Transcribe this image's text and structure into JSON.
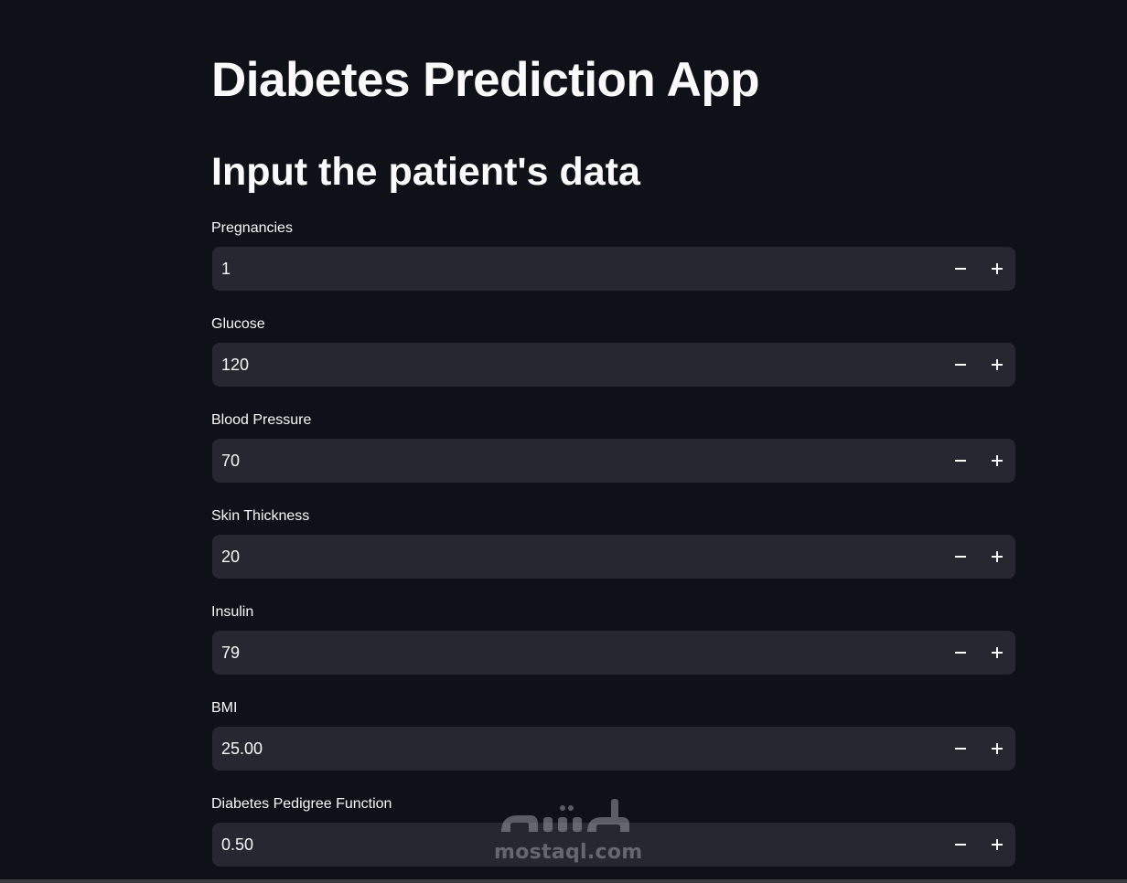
{
  "app": {
    "title": "Diabetes Prediction App",
    "section_title": "Input the patient's data"
  },
  "fields": [
    {
      "label": "Pregnancies",
      "value": "1"
    },
    {
      "label": "Glucose",
      "value": "120"
    },
    {
      "label": "Blood Pressure",
      "value": "70"
    },
    {
      "label": "Skin Thickness",
      "value": "20"
    },
    {
      "label": "Insulin",
      "value": "79"
    },
    {
      "label": "BMI",
      "value": "25.00"
    },
    {
      "label": "Diabetes Pedigree Function",
      "value": "0.50"
    }
  ],
  "icons": {
    "decrement": "minus-icon",
    "increment": "plus-icon"
  },
  "watermark": {
    "text": "mostaql.com"
  },
  "colors": {
    "background": "#0e1117",
    "input_background": "#262730",
    "text": "#fafafa"
  }
}
